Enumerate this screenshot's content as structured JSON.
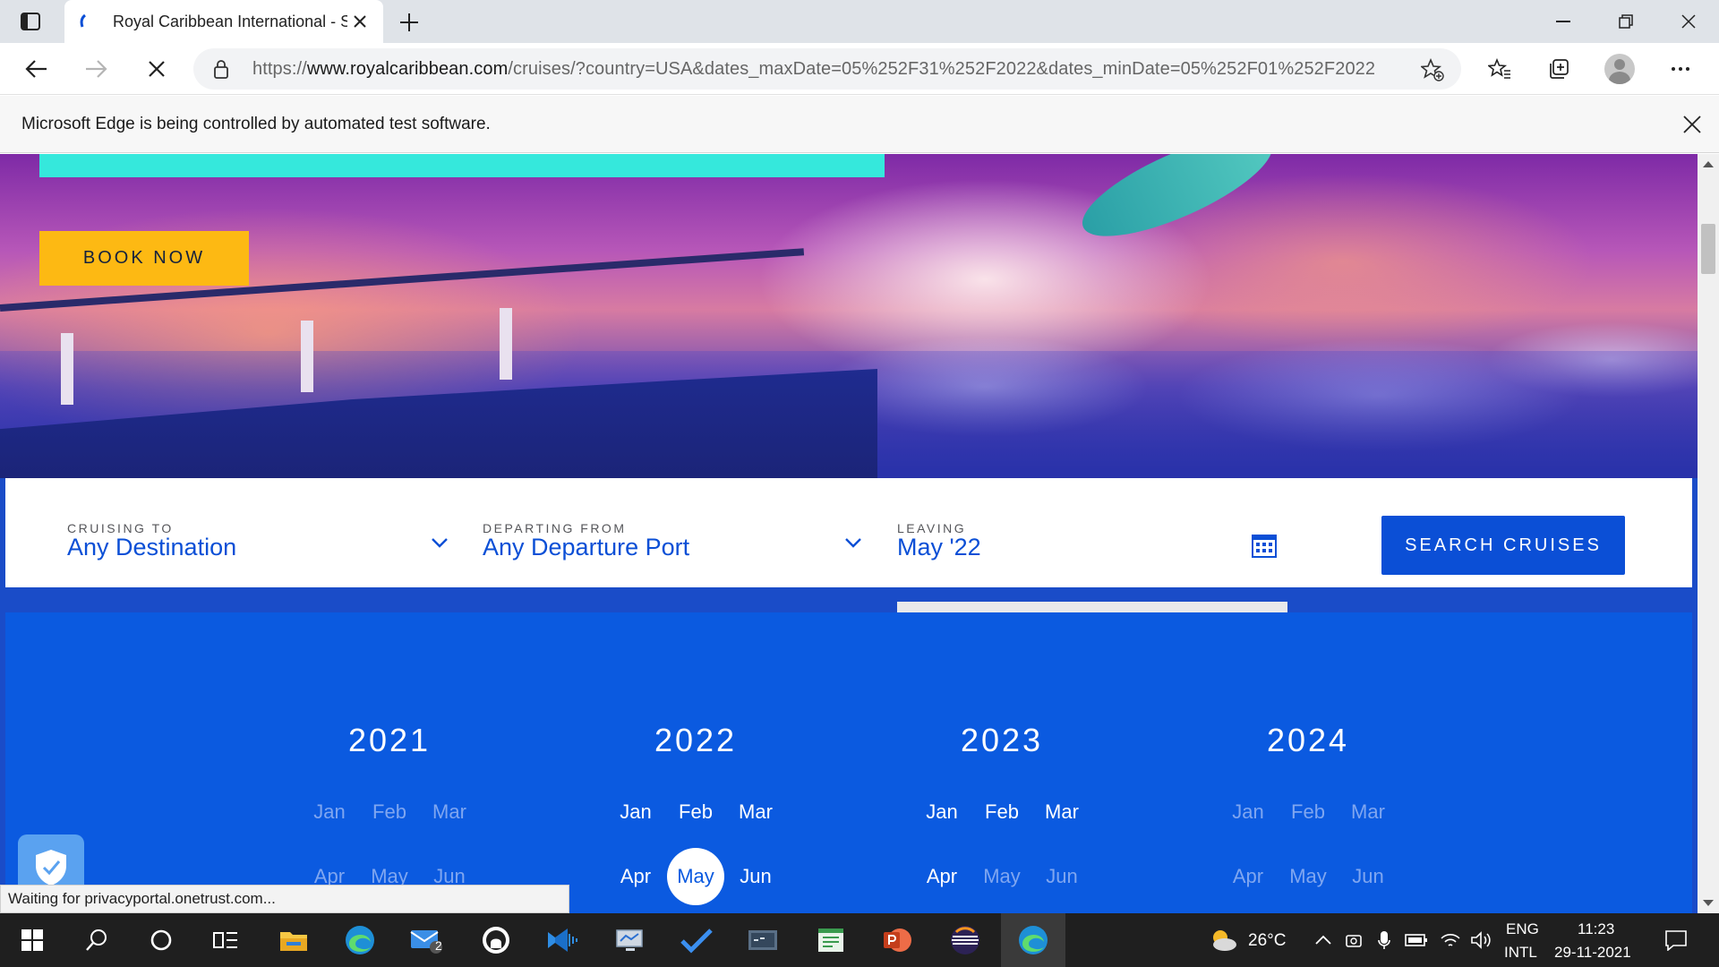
{
  "browser": {
    "tab_title": "Royal Caribbean International - S",
    "url_prefix": "https://",
    "url_host": "www.royalcaribbean.com",
    "url_rest": "/cruises/?country=USA&dates_maxDate=05%252F31%252F2022&dates_minDate=05%252F01%252F2022",
    "automation_notice": "Microsoft Edge is being controlled by automated test software.",
    "status_text": "Waiting for privacyportal.onetrust.com..."
  },
  "hero": {
    "book_now_label": "BOOK NOW"
  },
  "search": {
    "cruising_to": {
      "label": "CRUISING TO",
      "value": "Any Destination"
    },
    "departing_from": {
      "label": "DEPARTING FROM",
      "value": "Any Departure Port"
    },
    "leaving": {
      "label": "LEAVING",
      "value": "May '22"
    },
    "search_button_label": "SEARCH CRUISES"
  },
  "calendar": {
    "years": [
      {
        "year": "2021",
        "months": [
          {
            "label": "Jan",
            "state": "disabled"
          },
          {
            "label": "Feb",
            "state": "disabled"
          },
          {
            "label": "Mar",
            "state": "disabled"
          },
          {
            "label": "Apr",
            "state": "disabled"
          },
          {
            "label": "May",
            "state": "disabled"
          },
          {
            "label": "Jun",
            "state": "disabled"
          }
        ]
      },
      {
        "year": "2022",
        "months": [
          {
            "label": "Jan",
            "state": "enabled"
          },
          {
            "label": "Feb",
            "state": "enabled"
          },
          {
            "label": "Mar",
            "state": "enabled"
          },
          {
            "label": "Apr",
            "state": "enabled"
          },
          {
            "label": "May",
            "state": "selected"
          },
          {
            "label": "Jun",
            "state": "enabled"
          }
        ]
      },
      {
        "year": "2023",
        "months": [
          {
            "label": "Jan",
            "state": "enabled"
          },
          {
            "label": "Feb",
            "state": "enabled"
          },
          {
            "label": "Mar",
            "state": "enabled"
          },
          {
            "label": "Apr",
            "state": "enabled"
          },
          {
            "label": "May",
            "state": "disabled"
          },
          {
            "label": "Jun",
            "state": "disabled"
          }
        ]
      },
      {
        "year": "2024",
        "months": [
          {
            "label": "Jan",
            "state": "disabled"
          },
          {
            "label": "Feb",
            "state": "disabled"
          },
          {
            "label": "Mar",
            "state": "disabled"
          },
          {
            "label": "Apr",
            "state": "disabled"
          },
          {
            "label": "May",
            "state": "disabled"
          },
          {
            "label": "Jun",
            "state": "disabled"
          }
        ]
      }
    ]
  },
  "taskbar": {
    "weather_temp": "26°C",
    "lang_top": "ENG",
    "lang_bottom": "INTL",
    "time": "11:23",
    "date": "29-11-2021",
    "mail_badge": "2",
    "apps": [
      "start-icon",
      "search-icon",
      "cortana-icon",
      "task-view-icon",
      "file-explorer-icon",
      "edge-icon",
      "mail-icon",
      "github-icon",
      "visual-studio-icon",
      "remote-desktop-icon",
      "todo-icon",
      "sql-icon",
      "notepad-icon",
      "powerpoint-icon",
      "eclipse-icon",
      "edge-active-icon"
    ]
  },
  "colors": {
    "brand_blue": "#0b4fd6",
    "calendar_blue": "#0b5ae0",
    "book_now_yellow": "#fdb913",
    "disabled_month": "#7fa6f0"
  }
}
